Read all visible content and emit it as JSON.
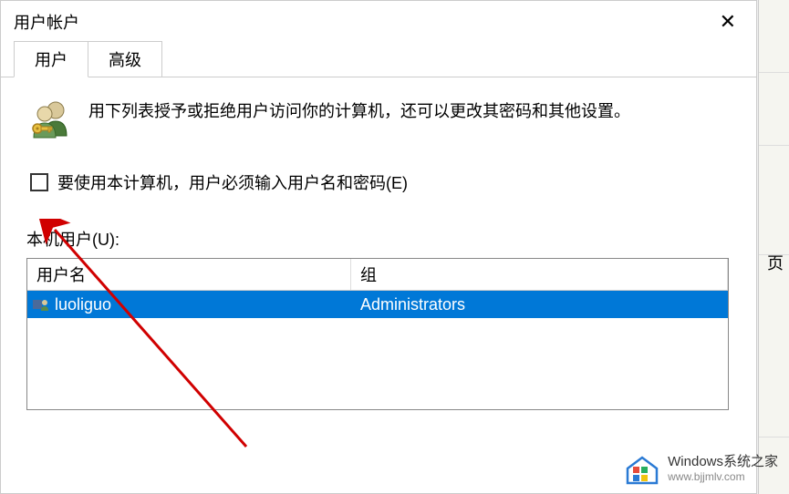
{
  "window": {
    "title": "用户帐户"
  },
  "tabs": {
    "users": "用户",
    "advanced": "高级"
  },
  "description": "用下列表授予或拒绝用户访问你的计算机，还可以更改其密码和其他设置。",
  "checkbox": {
    "label": "要使用本计算机，用户必须输入用户名和密码(E)",
    "checked": false
  },
  "list_label": "本机用户(U):",
  "table": {
    "col_username": "用户名",
    "col_group": "组",
    "rows": [
      {
        "username": "luoliguo",
        "group": "Administrators"
      }
    ]
  },
  "side_fragment": "页",
  "watermark": {
    "title": "Windows系统之家",
    "url": "www.bjjmlv.com"
  }
}
